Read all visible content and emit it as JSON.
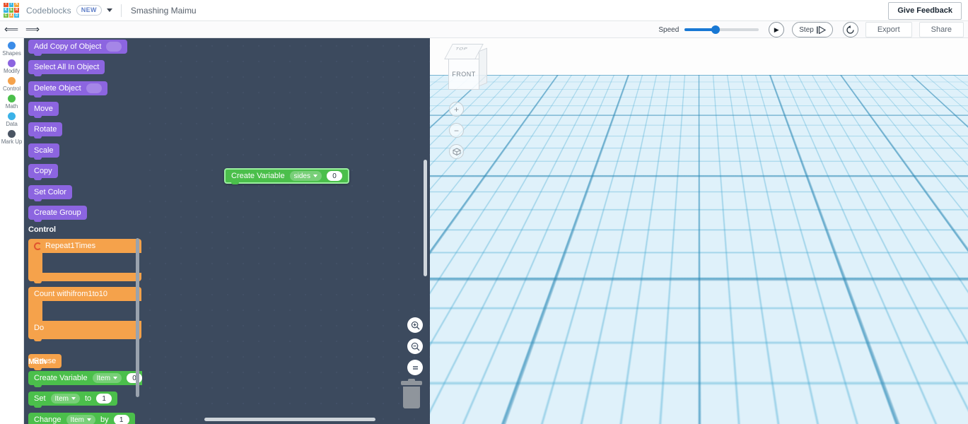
{
  "header": {
    "logo_letters": [
      "T",
      "I",
      "N",
      "K",
      "E",
      "R",
      "C",
      "A",
      "D"
    ],
    "logo_colors": [
      "#e8532e",
      "#3ab6e2",
      "#f1a33a",
      "#3ab6e2",
      "#74c044",
      "#e8532e",
      "#74c044",
      "#f1a33a",
      "#3ab6e2"
    ],
    "brand": "Codeblocks",
    "new_badge": "NEW",
    "doc_title": "Smashing Maimu",
    "feedback_label": "Give Feedback"
  },
  "toolbar": {
    "undo_icon": "undo-arrow-icon",
    "redo_icon": "redo-arrow-icon",
    "speed_label": "Speed",
    "speed_value": 42,
    "play_label": "▶",
    "step_label": "Step",
    "restart_icon": "restart-icon",
    "export_label": "Export",
    "share_label": "Share"
  },
  "rail": {
    "items": [
      {
        "label": "Shapes",
        "color": "#3b8ce8"
      },
      {
        "label": "Modify",
        "color": "#8c65e0"
      },
      {
        "label": "Control",
        "color": "#f5a24b"
      },
      {
        "label": "Math",
        "color": "#4bbf4b"
      },
      {
        "label": "Data",
        "color": "#3bb2e8"
      },
      {
        "label": "Mark Up",
        "color": "#4a5563"
      }
    ]
  },
  "palette": {
    "modify_blocks": [
      {
        "label": "Add Copy of Object",
        "slot": ""
      },
      {
        "label": "Select All In Object"
      },
      {
        "label": "Delete Object",
        "slot": ""
      },
      {
        "label": "Move"
      },
      {
        "label": "Rotate"
      },
      {
        "label": "Scale"
      },
      {
        "label": "Copy"
      },
      {
        "label": "Set Color"
      },
      {
        "label": "Create Group"
      }
    ],
    "control_header": "Control",
    "repeat": {
      "label": "Repeat",
      "count": "1",
      "suffix": "Times"
    },
    "count_with": {
      "label": "Count with",
      "var": "i",
      "from_label": "from",
      "from": "1",
      "to_label": "to",
      "to": "10",
      "do_label": "Do"
    },
    "pause": {
      "label": "Pause"
    },
    "math_header": "Math",
    "math_blocks": [
      {
        "label": "Create Variable",
        "var": "Item",
        "value": "0"
      },
      {
        "label": "Set",
        "var": "Item",
        "mid": "to",
        "value": "1"
      },
      {
        "label": "Change",
        "var": "Item",
        "mid": "by",
        "value": "1"
      }
    ]
  },
  "canvas": {
    "block": {
      "label": "Create Variable",
      "var": "sides",
      "value": "0"
    },
    "zoom_in_icon": "zoom-in-icon",
    "zoom_out_icon": "zoom-out-icon",
    "zoom_fit_icon": "zoom-fit-icon",
    "trash_icon": "trash-icon"
  },
  "viewport": {
    "viewcube_front": "FRONT",
    "viewcube_top": "TOP",
    "zoom_in": "+",
    "zoom_out": "−",
    "home_icon": "home-view-icon",
    "axis_colors": {
      "z": "#3b57e8",
      "y": "#22c41e",
      "x": "#ec2a24"
    }
  }
}
